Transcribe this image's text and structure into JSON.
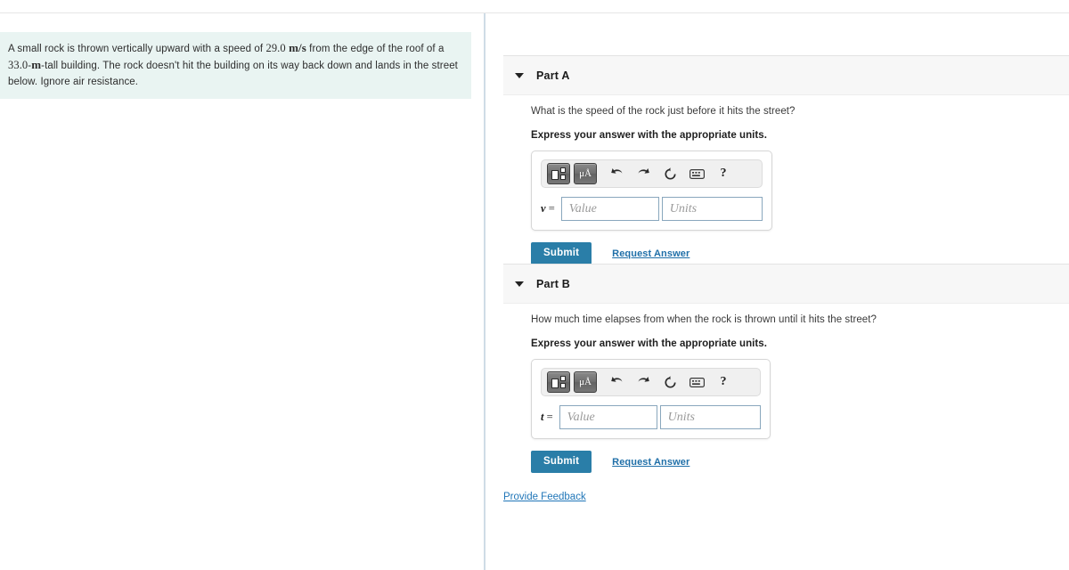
{
  "problem": {
    "text_before_speed": "A small rock is thrown vertically upward with a speed of ",
    "speed_value": "29.0",
    "speed_unit": "m/s",
    "text_middle": " from the edge of the roof of a ",
    "height_value": "33.0",
    "height_unit": "m",
    "height_suffix": "-tall",
    "text_after": "building. The rock doesn't hit the building on its way back down and lands in the street below. Ignore air resistance."
  },
  "parts": [
    {
      "title": "Part A",
      "caret": "chevron-down-icon",
      "question": "What is the speed of the rock just before it hits the street?",
      "instruction": "Express your answer with the appropriate units.",
      "variable": "v",
      "equals": " =",
      "value_placeholder": "Value",
      "units_placeholder": "Units",
      "value_current": "",
      "units_current": "",
      "submit_label": "Submit",
      "request_answer_label": "Request Answer"
    },
    {
      "title": "Part B",
      "caret": "chevron-down-icon",
      "question": "How much time elapses from when the rock is thrown until it hits the street?",
      "instruction": "Express your answer with the appropriate units.",
      "variable": "t",
      "equals": " =",
      "value_placeholder": "Value",
      "units_placeholder": "Units",
      "value_current": "",
      "units_current": "",
      "submit_label": "Submit",
      "request_answer_label": "Request Answer"
    }
  ],
  "toolbar": {
    "template_button_label": "",
    "template_icon": "math-template-icon",
    "symbols_button_label": "μÅ",
    "symbols_icon": "greek-symbols-icon",
    "undo_icon": "undo-arrow-icon",
    "redo_icon": "redo-arrow-icon",
    "reset_icon": "reset-circle-icon",
    "keyboard_icon": "keyboard-icon",
    "help_label": "?",
    "help_icon": "help-question-icon"
  },
  "footer": {
    "feedback_label": "Provide Feedback"
  },
  "colors": {
    "problem_panel_bg": "#e9f4f2",
    "part_header_bg": "#f7f7f7",
    "submit_blue": "#2a7ea8",
    "link_blue": "#1f6fa8",
    "field_border": "#89a7bd",
    "divider": "#cfdce6"
  }
}
